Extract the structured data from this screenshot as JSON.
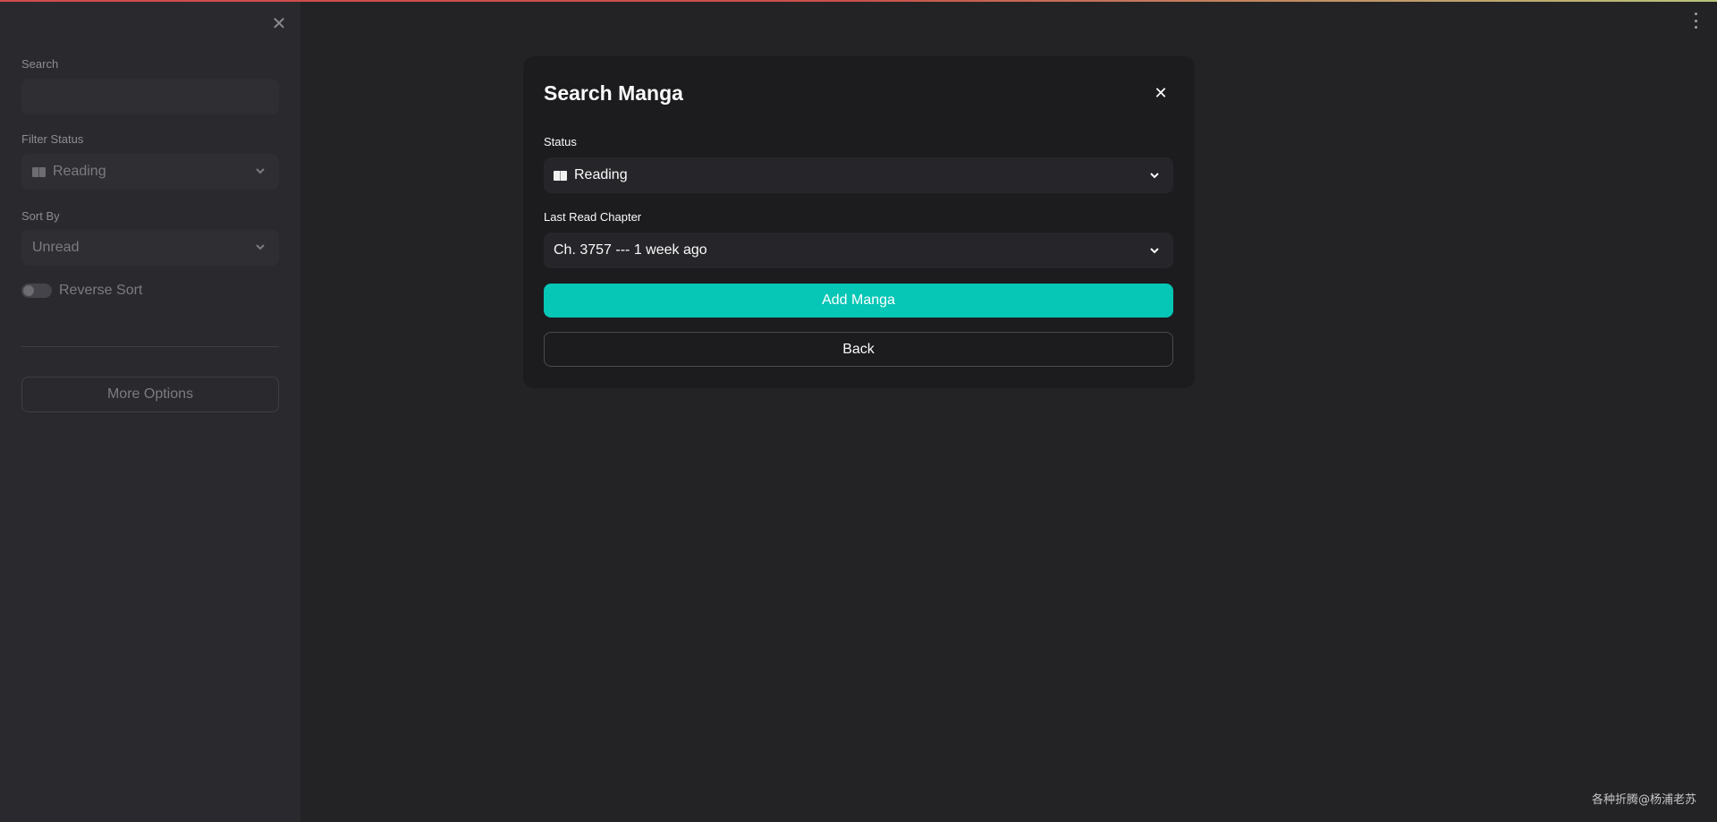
{
  "sidebar": {
    "search_label": "Search",
    "search_value": "",
    "filter_status_label": "Filter Status",
    "filter_status_value": "Reading",
    "sort_by_label": "Sort By",
    "sort_by_value": "Unread",
    "reverse_sort_label": "Reverse Sort",
    "reverse_sort_on": false,
    "more_options_label": "More Options"
  },
  "modal": {
    "title": "Search Manga",
    "status_label": "Status",
    "status_value": "Reading",
    "last_read_label": "Last Read Chapter",
    "last_read_value": "Ch. 3757 --- 1 week ago",
    "add_button_label": "Add Manga",
    "back_button_label": "Back"
  },
  "icons": {
    "sidebar_close": "close-icon",
    "modal_close": "close-icon",
    "menu": "kebab-menu-icon",
    "book": "book-icon",
    "chevron": "chevron-down-icon"
  },
  "colors": {
    "accent": "#06c6b6",
    "background": "#232326",
    "sidebar": "#2a2a2e",
    "modal": "#1c1c1f"
  },
  "watermark": "各种折腾@杨浦老苏"
}
